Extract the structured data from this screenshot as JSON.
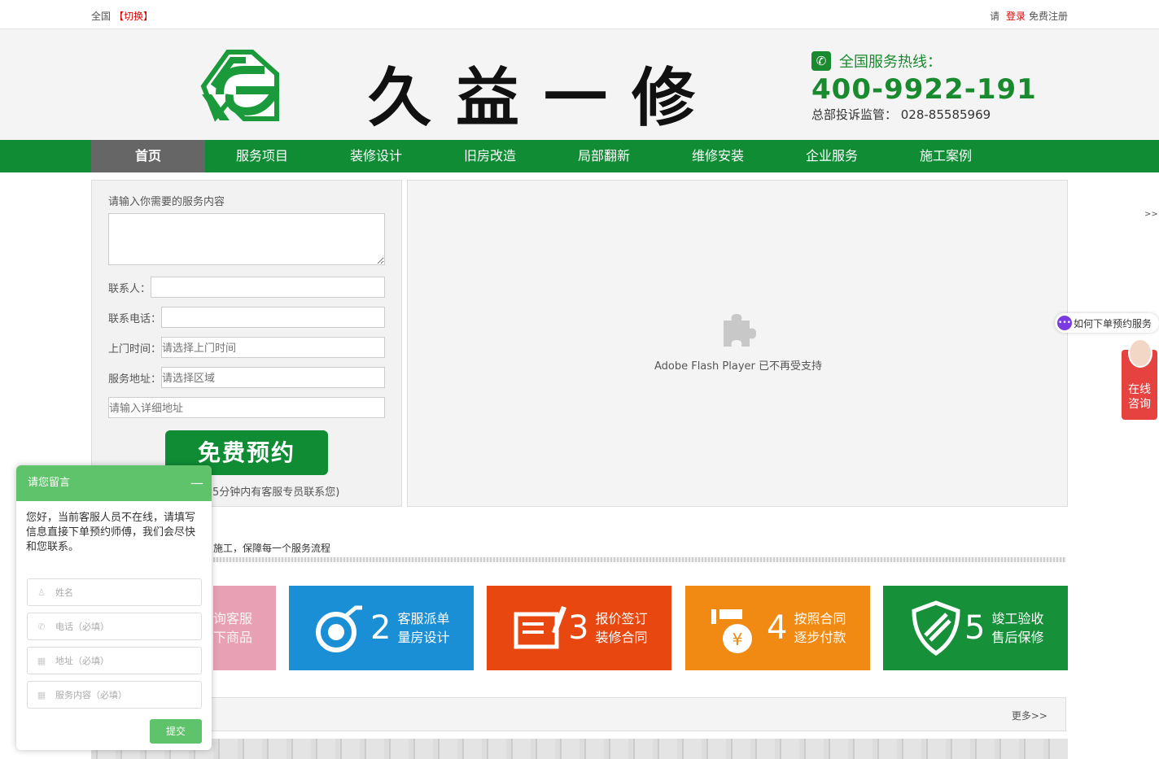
{
  "topbar": {
    "region": "全国",
    "switch": "【切换】",
    "please": "请",
    "login": "登录",
    "register": "免费注册"
  },
  "header": {
    "brand": "久益一修",
    "hotline_label": "全国服务热线：",
    "hotline_number": "400-9922-191",
    "supervision": "总部投诉监管：  028-85585969"
  },
  "nav": {
    "items": [
      "首页",
      "服务项目",
      "装修设计",
      "旧房改造",
      "局部翻新",
      "维修安装",
      "企业服务",
      "施工案例"
    ]
  },
  "form": {
    "title": "请输入你需要的服务内容",
    "contact_label": "联系人：",
    "phone_label": "联系电话：",
    "time_label": "上门时间：",
    "time_placeholder": "请选择上门时间",
    "area_label": "服务地址：",
    "area_placeholder": "请选择区域",
    "detail_placeholder": "请输入详细地址",
    "submit": "免费预约",
    "note": "5分钟内有客服专员联系您)"
  },
  "flash": {
    "message": "Adobe Flash Player 已不再受支持"
  },
  "process": {
    "desc": "施工，保障每一个服务流程",
    "steps": [
      {
        "num": "",
        "line1": "询客服",
        "line2": "下商品",
        "color": "#e8a0b4"
      },
      {
        "num": "2",
        "line1": "客服派单",
        "line2": "量房设计",
        "color": "#1a8fd6"
      },
      {
        "num": "3",
        "line1": "报价签订",
        "line2": "装修合同",
        "color": "#e8470f"
      },
      {
        "num": "4",
        "line1": "按照合同",
        "line2": "逐步付款",
        "color": "#f08a12"
      },
      {
        "num": "5",
        "line1": "竣工验收",
        "line2": "售后保修",
        "color": "#16913a"
      }
    ]
  },
  "more": "更多>>",
  "side": {
    "arrows": ">>",
    "howto": "如何下单预约服务",
    "online_1": "在线",
    "online_2": "咨询"
  },
  "chat": {
    "title": "请您留言",
    "minimize": "—",
    "message": "您好，当前客服人员不在线，请填写信息直接下单预约师傅，我们会尽快和您联系。",
    "name": "姓名",
    "phone": "电话（必填）",
    "address": "地址（必填）",
    "content": "服务内容（必填）",
    "submit": "提交"
  }
}
